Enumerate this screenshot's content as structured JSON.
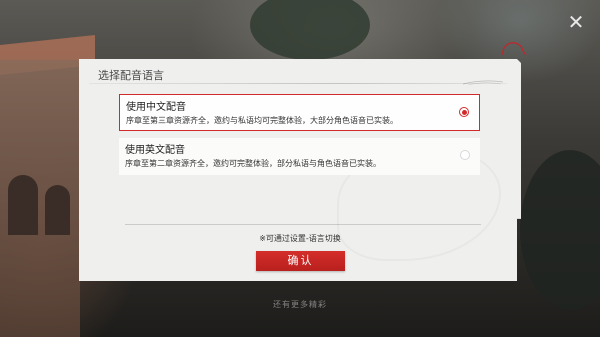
{
  "dialog": {
    "title": "选择配音语言",
    "hint": "※可通过设置-语言切换",
    "confirm_label": "确认"
  },
  "options": [
    {
      "title": "使用中文配音",
      "desc": "序章至第三章资源齐全，邀约与私语均可完整体验，大部分角色语音已实装。",
      "selected": true
    },
    {
      "title": "使用英文配音",
      "desc": "序章至第二章资源齐全，邀约可完整体验，部分私语与角色语音已实装。",
      "selected": false
    }
  ],
  "background": {
    "bottom_hint": "还有更多精彩"
  },
  "colors": {
    "accent": "#d22a2a",
    "dialog_bg": "#efefed"
  },
  "icons": {
    "close": "close-icon"
  }
}
